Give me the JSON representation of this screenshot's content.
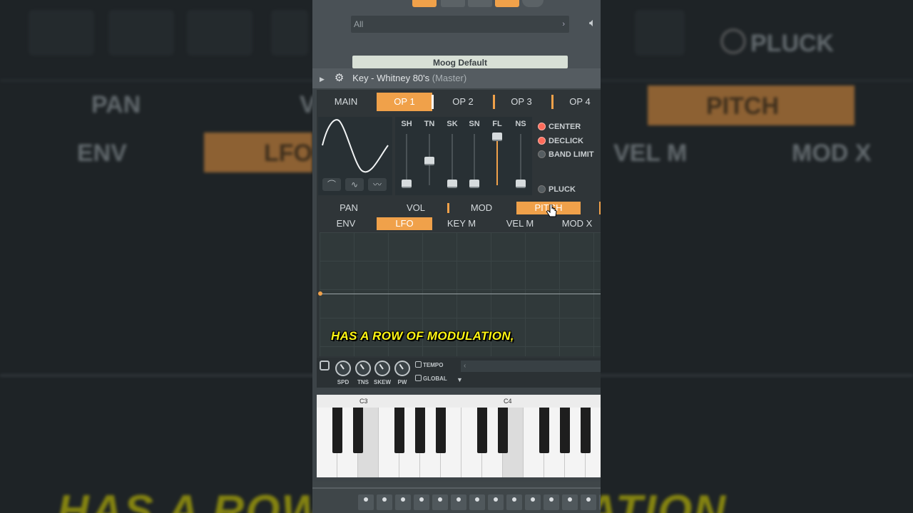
{
  "background": {
    "left_tabs_row1": [
      "PAN",
      "V"
    ],
    "left_tabs_row2": [
      "ENV",
      "LFO"
    ],
    "right_tabs_row1": [
      "PITCH"
    ],
    "right_tabs_row2": [
      "VEL M",
      "MOD X"
    ],
    "right_check": "PLUCK",
    "caption": "HAS A ROW OF MODULATION,"
  },
  "browser": {
    "filter_label": "All",
    "preset_name": "Moog Default"
  },
  "window": {
    "title_main": "Key - Whitney 80's",
    "title_sub": "(Master)"
  },
  "op_tabs": [
    "MAIN",
    "OP 1",
    "OP 2",
    "OP 3",
    "OP 4"
  ],
  "active_op_tab": "OP 1",
  "slider_labels": [
    "SH",
    "TN",
    "SK",
    "SN",
    "FL",
    "NS"
  ],
  "checks": {
    "center": "CENTER",
    "declick": "DECLICK",
    "band_limit": "BAND LIMIT",
    "pluck": "PLUCK"
  },
  "mod_tabs": [
    "PAN",
    "VOL",
    "MOD",
    "PITCH"
  ],
  "active_mod_tab": "PITCH",
  "sub_tabs": [
    "ENV",
    "LFO",
    "KEY M",
    "VEL M",
    "MOD X"
  ],
  "active_sub_tab": "LFO",
  "lfo": {
    "knobs": [
      "SPD",
      "TNS",
      "SKEW",
      "PW"
    ],
    "tempo": "TEMPO",
    "global": "GLOBAL"
  },
  "caption": "HAS A ROW OF MODULATION,",
  "keyboard": {
    "labels": [
      "C3",
      "C4"
    ]
  },
  "colors": {
    "accent": "#f0a14a",
    "caption": "#fff614"
  }
}
